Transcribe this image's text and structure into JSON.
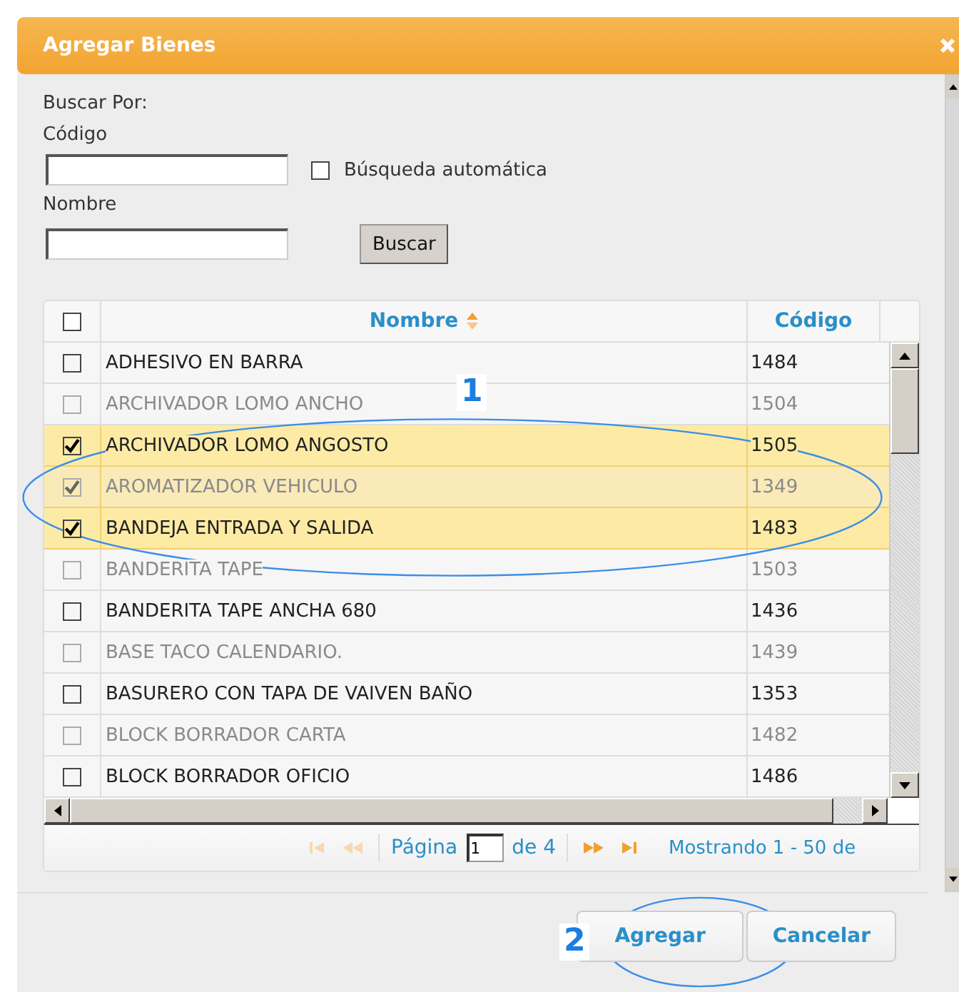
{
  "dialog": {
    "title": "Agregar Bienes"
  },
  "search": {
    "heading": "Buscar Por:",
    "code_label": "Código",
    "auto_search": {
      "label": "Búsqueda automática",
      "checked": false
    },
    "name_label": "Nombre",
    "button": "Buscar"
  },
  "table": {
    "select_all": {
      "checked": false
    },
    "columns": [
      {
        "label": "Nombre",
        "sorted": true
      },
      {
        "label": "Código",
        "sorted": false
      }
    ],
    "rows": [
      {
        "name": "ADHESIVO EN BARRA",
        "code": "1484",
        "checked": false,
        "disabled": false
      },
      {
        "name": "ARCHIVADOR LOMO ANCHO",
        "code": "1504",
        "checked": false,
        "disabled": true
      },
      {
        "name": "ARCHIVADOR LOMO ANGOSTO",
        "code": "1505",
        "checked": true,
        "disabled": false
      },
      {
        "name": "AROMATIZADOR VEHICULO",
        "code": "1349",
        "checked": true,
        "disabled": true
      },
      {
        "name": "BANDEJA ENTRADA Y SALIDA",
        "code": "1483",
        "checked": true,
        "disabled": false
      },
      {
        "name": "BANDERITA TAPE",
        "code": "1503",
        "checked": false,
        "disabled": true
      },
      {
        "name": "BANDERITA TAPE ANCHA 680",
        "code": "1436",
        "checked": false,
        "disabled": false
      },
      {
        "name": "BASE TACO CALENDARIO.",
        "code": "1439",
        "checked": false,
        "disabled": true
      },
      {
        "name": "BASURERO CON TAPA DE VAIVEN BAÑO",
        "code": "1353",
        "checked": false,
        "disabled": false
      },
      {
        "name": "BLOCK BORRADOR CARTA",
        "code": "1482",
        "checked": false,
        "disabled": true
      },
      {
        "name": "BLOCK BORRADOR OFICIO",
        "code": "1486",
        "checked": false,
        "disabled": false
      }
    ]
  },
  "pager": {
    "back_enabled": false,
    "forward_enabled": true,
    "page_label": "Página",
    "page": "1",
    "total": "de 4",
    "summary": "Mostrando 1 - 50 de"
  },
  "buttons": [
    "Agregar",
    "Cancelar"
  ],
  "annotations": [
    {
      "label": "1"
    },
    {
      "label": "2"
    }
  ]
}
